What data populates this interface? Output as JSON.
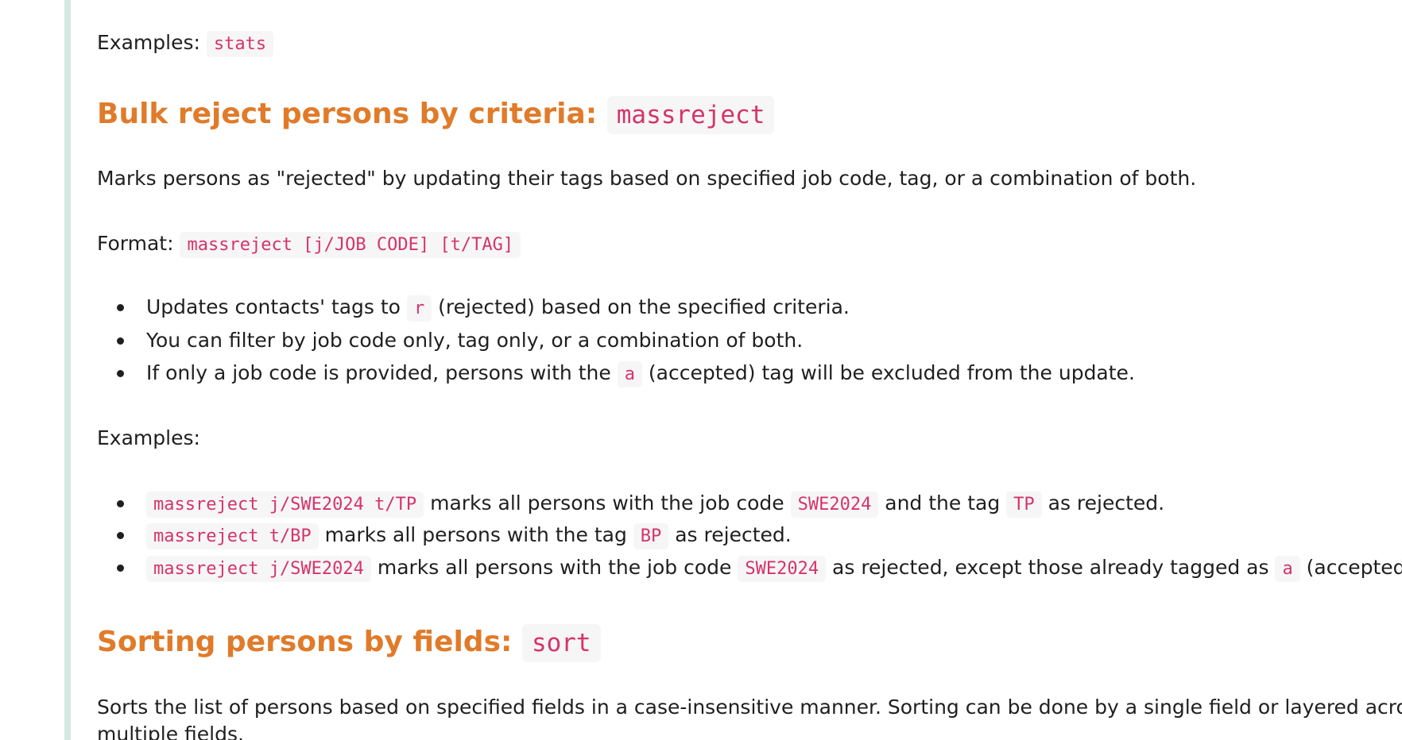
{
  "stats_examples": {
    "label": "Examples:",
    "code": "stats"
  },
  "massreject": {
    "heading": "Bulk reject persons by criteria:",
    "heading_code": "massreject",
    "description": "Marks persons as \"rejected\" by updating their tags based on specified job code, tag, or a combination of both.",
    "format_label": "Format:",
    "format_code": "massreject [j/JOB CODE] [t/TAG]",
    "bullets": [
      {
        "pre": "Updates contacts' tags to",
        "code": "r",
        "post": "(rejected) based on the specified criteria."
      },
      {
        "text": "You can filter by job code only, tag only, or a combination of both."
      },
      {
        "pre": "If only a job code is provided, persons with the",
        "code": "a",
        "post": "(accepted) tag will be excluded from the update."
      }
    ],
    "examples_label": "Examples:",
    "examples": [
      {
        "code1": "massreject j/SWE2024 t/TP",
        "t1": "marks all persons with the job code",
        "code2": "SWE2024",
        "t2": "and the tag",
        "code3": "TP",
        "t3": "as rejected."
      },
      {
        "code1": "massreject t/BP",
        "t1": "marks all persons with the tag",
        "code2": "BP",
        "t2": "as rejected."
      },
      {
        "code1": "massreject j/SWE2024",
        "t1": "marks all persons with the job code",
        "code2": "SWE2024",
        "t2": "as rejected, except those already tagged as",
        "code3": "a",
        "t3": "(accepted)."
      }
    ]
  },
  "sort": {
    "heading": "Sorting persons by fields:",
    "heading_code": "sort",
    "description_line1": "Sorts the list of persons based on specified fields in a case-insensitive manner. Sorting can be done by a single field or layered across",
    "description_line2": "multiple fields."
  }
}
